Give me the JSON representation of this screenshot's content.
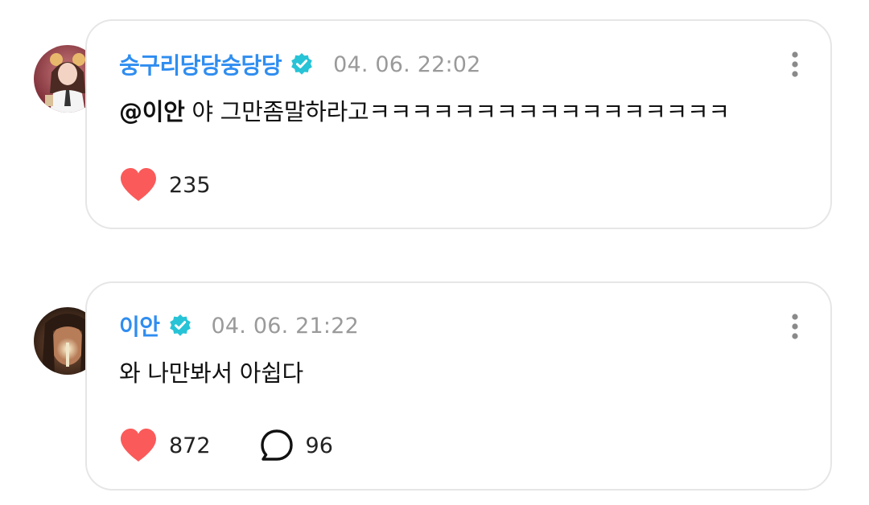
{
  "colors": {
    "username": "#2f8df0",
    "verified_badge": "#27c3d6",
    "heart": "#fb5a5a",
    "timestamp": "#9a9a9a",
    "card_border": "#e6e6e6"
  },
  "comments": [
    {
      "username": "숭구리당당숭당당",
      "verified": true,
      "timestamp": "04. 06. 22:02",
      "mention": "@이안",
      "text": " 야 그만좀말하라고ㅋㅋㅋㅋㅋㅋㅋㅋㅋㅋㅋㅋㅋㅋㅋㅋㅋ",
      "likes": "235",
      "avatar_icon": "user-avatar",
      "like_icon": "heart-icon",
      "menu_icon": "more-vertical-icon"
    },
    {
      "username": "이안",
      "verified": true,
      "timestamp": "04. 06. 21:22",
      "mention": "",
      "text": "와 나만봐서 아쉽다",
      "likes": "872",
      "replies": "96",
      "avatar_icon": "user-avatar",
      "like_icon": "heart-icon",
      "reply_icon": "speech-bubble-icon",
      "menu_icon": "more-vertical-icon"
    }
  ]
}
